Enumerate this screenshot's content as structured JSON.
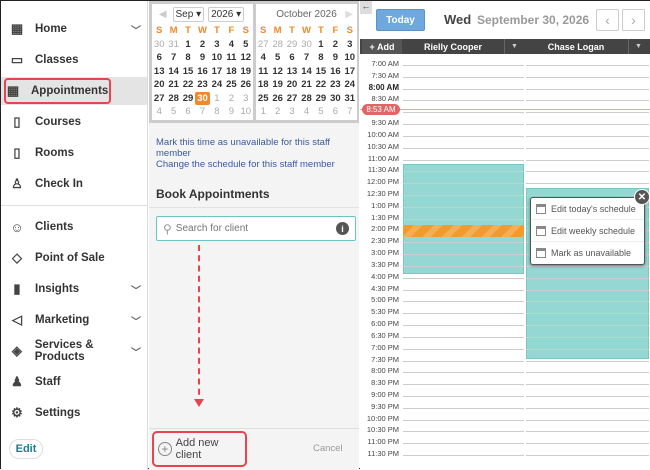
{
  "sidebar": {
    "items": [
      {
        "label": "Home",
        "icon": "grid-icon",
        "chevron": true
      },
      {
        "label": "Classes",
        "icon": "calendar-icon"
      },
      {
        "label": "Appointments",
        "icon": "calendar-dots-icon",
        "active": true
      },
      {
        "label": "Courses",
        "icon": "book-icon"
      },
      {
        "label": "Rooms",
        "icon": "door-icon"
      },
      {
        "label": "Check In",
        "icon": "user-check-icon"
      },
      {
        "label": "Clients",
        "icon": "users-icon"
      },
      {
        "label": "Point of Sale",
        "icon": "tag-icon"
      },
      {
        "label": "Insights",
        "icon": "bar-chart-icon",
        "chevron": true
      },
      {
        "label": "Marketing",
        "icon": "megaphone-icon",
        "chevron": true
      },
      {
        "label": "Services & Products",
        "icon": "shapes-icon",
        "chevron": true
      },
      {
        "label": "Staff",
        "icon": "staff-icon"
      },
      {
        "label": "Settings",
        "icon": "gear-icon"
      }
    ],
    "edit_label": "Edit"
  },
  "calendar": {
    "month_select": "Sep",
    "year_select": "2026",
    "second_month_title": "October 2026",
    "day_headers": [
      "S",
      "M",
      "T",
      "W",
      "T",
      "F",
      "S"
    ],
    "sep_days": [
      "30",
      "31",
      "1",
      "2",
      "3",
      "4",
      "5",
      "6",
      "7",
      "8",
      "9",
      "10",
      "11",
      "12",
      "13",
      "14",
      "15",
      "16",
      "17",
      "18",
      "19",
      "20",
      "21",
      "22",
      "23",
      "24",
      "25",
      "26",
      "27",
      "28",
      "29",
      "30",
      "1",
      "2",
      "3",
      "4",
      "5",
      "6",
      "7",
      "8",
      "9",
      "10"
    ],
    "oct_days": [
      "27",
      "28",
      "29",
      "30",
      "1",
      "2",
      "3",
      "4",
      "5",
      "6",
      "7",
      "8",
      "9",
      "10",
      "11",
      "12",
      "13",
      "14",
      "15",
      "16",
      "17",
      "18",
      "19",
      "20",
      "21",
      "22",
      "23",
      "24",
      "25",
      "26",
      "27",
      "28",
      "29",
      "30",
      "31",
      "1",
      "2",
      "3",
      "4",
      "5",
      "6",
      "7"
    ]
  },
  "links": {
    "mark_unavailable": "Mark this time as unavailable for this staff member",
    "change_schedule": "Change the schedule for this staff member"
  },
  "booking": {
    "title": "Book Appointments",
    "search_placeholder": "Search for client",
    "add_new_client": "Add new client",
    "cancel": "Cancel"
  },
  "schedule": {
    "today_label": "Today",
    "day_of_week": "Wed",
    "date": "September 30, 2026",
    "add_label": "+ Add",
    "staff": [
      "Rielly Cooper",
      "Chase Logan"
    ],
    "current_time": "8:53 AM",
    "times": [
      "7:00 AM",
      "7:30 AM",
      "8:00 AM",
      "8:30 AM",
      "",
      "9:30 AM",
      "10:00 AM",
      "10:30 AM",
      "11:00 AM",
      "11:30 AM",
      "12:00 PM",
      "12:30 PM",
      "1:00 PM",
      "1:30 PM",
      "2:00 PM",
      "2:30 PM",
      "3:00 PM",
      "3:30 PM",
      "4:00 PM",
      "4:30 PM",
      "5:00 PM",
      "5:30 PM",
      "6:00 PM",
      "6:30 PM",
      "7:00 PM",
      "7:30 PM",
      "8:00 PM",
      "8:30 PM",
      "9:00 PM",
      "9:30 PM",
      "10:00 PM",
      "10:30 PM",
      "11:00 PM",
      "11:30 PM"
    ],
    "availability_color": "#94d7d3",
    "unavailable_color": "#f29a2e"
  },
  "popover": {
    "items": [
      "Edit today's schedule",
      "Edit weekly schedule",
      "Mark as unavailable"
    ]
  },
  "colors": {
    "accent": "#e8434e",
    "today_button": "#6fa8dc",
    "today_date": "#f0892b"
  }
}
